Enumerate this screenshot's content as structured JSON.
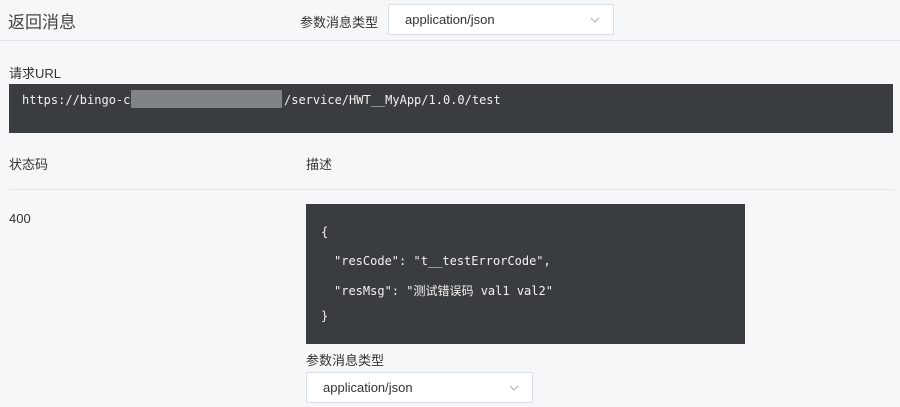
{
  "header": {
    "title": "返回消息",
    "content_type_label": "参数消息类型",
    "content_type_value": "application/json"
  },
  "request": {
    "label": "请求URL",
    "url_prefix": "https://bingo-c",
    "url_suffix": "/service/HWT__MyApp/1.0.0/test"
  },
  "table": {
    "col_status": "状态码",
    "col_desc": "描述"
  },
  "response": {
    "status_code": "400",
    "code_lines": [
      "{",
      "\"resCode\": \"t__testErrorCode\",",
      "\"resMsg\": \"测试错误码 val1 val2\"",
      "}"
    ],
    "content_type_label": "参数消息类型",
    "content_type_value": "application/json"
  },
  "colors": {
    "background": "#f6f7f8",
    "code_bg": "#3a3d40",
    "code_text": "#f2f2f2",
    "border": "#dcdfe6"
  },
  "icons": {
    "select_chevron": "chevron-down-icon"
  }
}
